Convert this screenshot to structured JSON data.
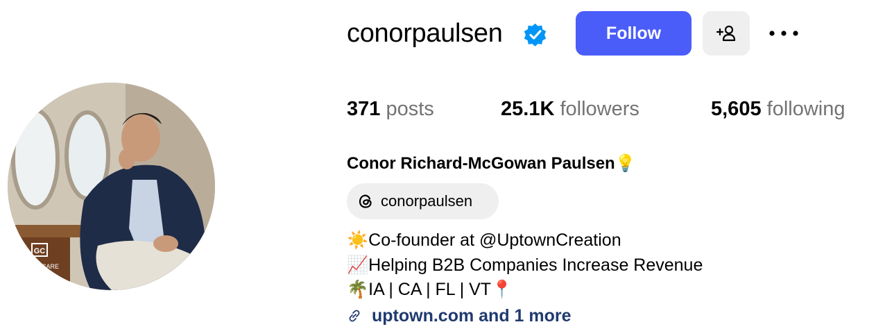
{
  "profile": {
    "username": "conorpaulsen",
    "verified": true,
    "follow_label": "Follow",
    "add_user_label": "+○",
    "more_label": "•••",
    "stats": {
      "posts_count": "371",
      "posts_label": "posts",
      "followers_count": "25.1K",
      "followers_label": "followers",
      "following_count": "5,605",
      "following_label": "following"
    },
    "full_name": "Conor Richard-McGowan Paulsen",
    "full_name_emoji": "💡",
    "threads_handle": "conorpaulsen",
    "bio": [
      {
        "emoji": "☀️",
        "text": "Co-founder at @UptownCreation"
      },
      {
        "emoji": "📈",
        "text": "Helping B2B Companies Increase Revenue"
      },
      {
        "emoji": "🌴",
        "text": "IA | CA | FL | VT",
        "emoji_after": "📍"
      }
    ],
    "link_text": "uptown.com and 1 more",
    "avatar_badge_text": "GC",
    "avatar_badge_sub": "N CARE"
  },
  "colors": {
    "follow_bg": "#4a5df9",
    "verified_badge": "#0095f6",
    "secondary_text": "#737373",
    "link_text": "#1f3a6e",
    "pill_bg": "#efefef"
  }
}
